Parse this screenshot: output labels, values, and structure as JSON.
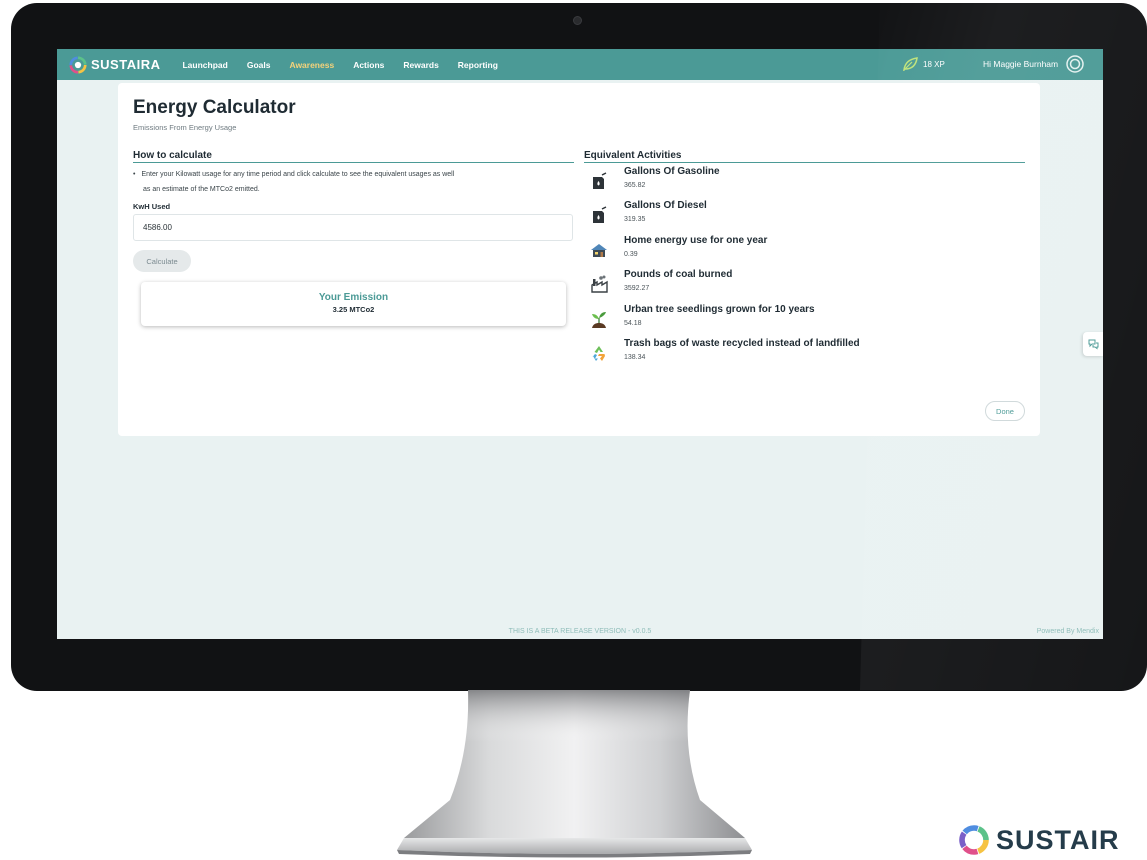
{
  "app": {
    "brand": "SUSTAIRA",
    "nav": [
      {
        "label": "Launchpad",
        "active": false
      },
      {
        "label": "Goals",
        "active": false
      },
      {
        "label": "Awareness",
        "active": true
      },
      {
        "label": "Actions",
        "active": false
      },
      {
        "label": "Rewards",
        "active": false
      },
      {
        "label": "Reporting",
        "active": false
      }
    ],
    "xp": "18 XP",
    "greeting": "Hi Maggie Burnham",
    "accent_color": "#4b9a96",
    "active_color": "#f5d27a"
  },
  "page": {
    "title": "Energy Calculator",
    "subtitle": "Emissions From Energy Usage"
  },
  "how_to": {
    "heading": "How to calculate",
    "line1": "Enter your Kilowatt usage for any time period and click calculate to see the equivalent usages as well",
    "line2": "as an estimate of the MTCo2 emitted.",
    "input_label": "KwH Used",
    "input_value": "4586.00",
    "calculate_label": "Calculate"
  },
  "emission": {
    "title": "Your Emission",
    "value": "3.25 MTCo2"
  },
  "equivalents": {
    "heading": "Equivalent Activities",
    "items": [
      {
        "icon": "gas-can-icon",
        "title": "Gallons Of Gasoline",
        "value": "365.82"
      },
      {
        "icon": "diesel-can-icon",
        "title": "Gallons Of Diesel",
        "value": "319.35"
      },
      {
        "icon": "house-icon",
        "title": "Home energy use for one year",
        "value": "0.39"
      },
      {
        "icon": "factory-icon",
        "title": "Pounds of coal burned",
        "value": "3592.27"
      },
      {
        "icon": "seedling-icon",
        "title": "Urban tree seedlings grown for 10 years",
        "value": "54.18"
      },
      {
        "icon": "recycle-icon",
        "title": "Trash bags of waste recycled instead of landfilled",
        "value": "138.34"
      }
    ]
  },
  "done_label": "Done",
  "footer": {
    "version": "THIS IS A BETA RELEASE VERSION - v0.0.5",
    "powered": "Powered By Mendix"
  },
  "corner_brand": "SUSTAIR"
}
